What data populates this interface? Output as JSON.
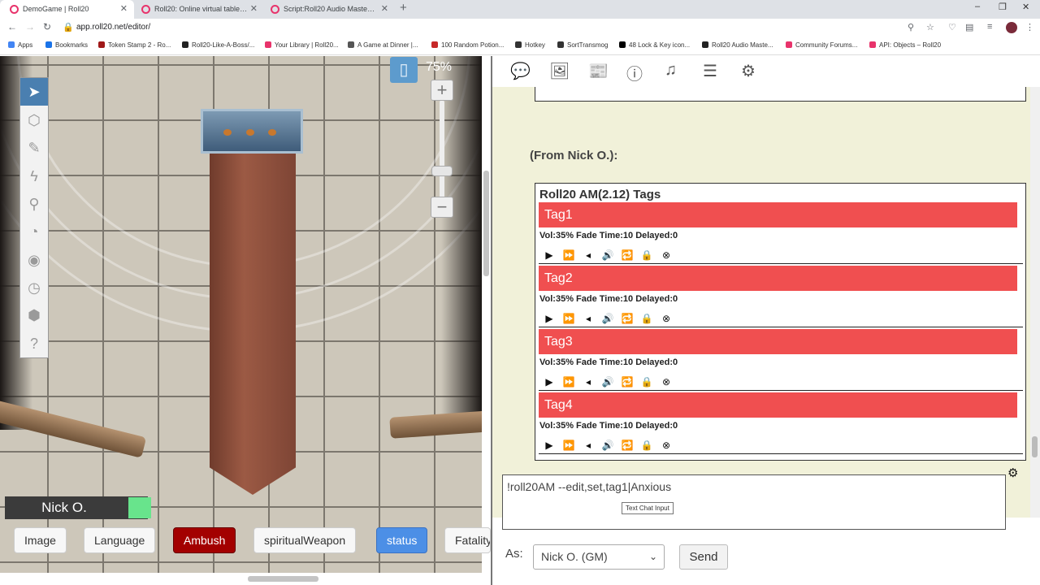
{
  "browser": {
    "tabs": [
      {
        "label": "DemoGame | Roll20"
      },
      {
        "label": "Roll20: Online virtual tabletop fo..."
      },
      {
        "label": "Script:Roll20 Audio Master - Roll..."
      }
    ],
    "url": "app.roll20.net/editor/",
    "bookmarks": [
      "Apps",
      "Bookmarks",
      "Token Stamp 2 - Ro...",
      "Roll20-Like-A-Boss/...",
      "Your Library | Roll20...",
      "A Game at Dinner |...",
      "100 Random Potion...",
      "Hotkey",
      "SortTransmog",
      "48 Lock & Key icon...",
      "Roll20 Audio Maste...",
      "Community Forums...",
      "API: Objects – Roll20"
    ]
  },
  "map": {
    "zoom_level": "75%",
    "player_name": "Nick O.",
    "player_color": "#68e48c",
    "macros": [
      "Image",
      "Language",
      "Ambush",
      "spiritualWeapon",
      "status",
      "Fatality"
    ],
    "tools": [
      "select-icon",
      "token-layer-icon",
      "draw-icon",
      "fx-icon",
      "zoom-icon",
      "measure-icon",
      "fog-icon",
      "turn-tracker-icon",
      "dice-icon",
      "help-icon"
    ]
  },
  "chat": {
    "from_line": "(From Nick O.):",
    "box_title": "Roll20 AM(2.12) Tags",
    "tags": [
      {
        "name": "Tag1",
        "meta": "Vol:35% Fade Time:10 Delayed:0"
      },
      {
        "name": "Tag2",
        "meta": "Vol:35% Fade Time:10 Delayed:0"
      },
      {
        "name": "Tag3",
        "meta": "Vol:35% Fade Time:10 Delayed:0"
      },
      {
        "name": "Tag4",
        "meta": "Vol:35% Fade Time:10 Delayed:0"
      }
    ],
    "input_value": "!roll20AM --edit,set,tag1|Anxious",
    "tooltip": "Text Chat Input",
    "as_label": "As:",
    "as_value": "Nick O. (GM)",
    "send_label": "Send",
    "tag_color": "#f04f50"
  }
}
